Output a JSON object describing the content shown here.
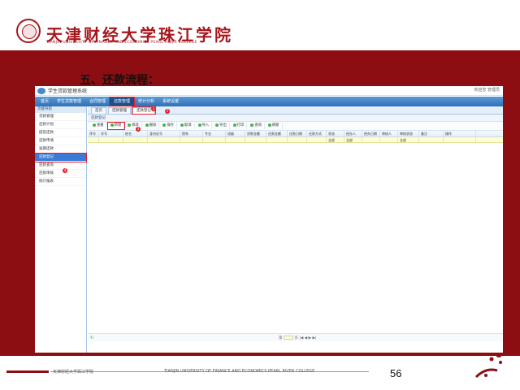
{
  "header": {
    "school_cn": "天津财经大学珠江学院",
    "school_en": "TIANJIN UNIVERSITY OF FINANCE AND ECONOMICS PEARL RIVER COLLEGE"
  },
  "slide": {
    "title": "五、还款流程："
  },
  "app": {
    "title": "学生贷款管理系统",
    "user": "欢迎您 管理员",
    "menu": [
      "首页",
      "学生贷款管理",
      "合同管理",
      "还款管理",
      "统计分析",
      "系统设置"
    ],
    "active_menu": 3,
    "sidebar": {
      "head": "功能导航",
      "items": [
        "贷款管理",
        "还款计划",
        "提前还款",
        "还款申请",
        "逾期还款",
        "还款登记",
        "还款查询",
        "还款审核",
        "统计报表"
      ],
      "active_index": 5
    },
    "tabs": [
      "首页",
      "还款管理",
      "还款登记"
    ],
    "active_tab": 2,
    "panel_title": "还款登记",
    "toolbar": [
      "查看",
      "新增",
      "修改",
      "删除",
      "保存",
      "取消",
      "导入",
      "导出",
      "打印",
      "查询",
      "刷新"
    ],
    "active_tool": 1,
    "columns": [
      "序号",
      "学号",
      "姓名",
      "身份证号",
      "院系",
      "专业",
      "班级",
      "贷款金额",
      "还款金额",
      "还款日期",
      "还款方式",
      "状态",
      "经办人",
      "经办日期",
      "审核人",
      "审核状态",
      "备注",
      "操作"
    ],
    "filter_values": [
      "",
      "",
      "",
      "",
      "",
      "",
      "",
      "",
      "",
      "",
      "",
      "全部",
      "全部",
      "",
      "",
      "全部",
      "",
      ""
    ],
    "pager": {
      "prefix": "第",
      "suffix": "页",
      "controls": "|◀ ◀ ▶ ▶|"
    },
    "markers": [
      "1",
      "2",
      "3",
      "4"
    ]
  },
  "footer": {
    "cn": "天津财经大学珠江学院",
    "en": "TIANJIN UNIVERSITY OF FINANCE AND ECONOMICS PEARL RIVER COLLEGE",
    "page": "56"
  },
  "colors": {
    "brand_red": "#8d0e12",
    "accent_blue": "#2f6fb4",
    "marker_red": "#e8202a"
  }
}
